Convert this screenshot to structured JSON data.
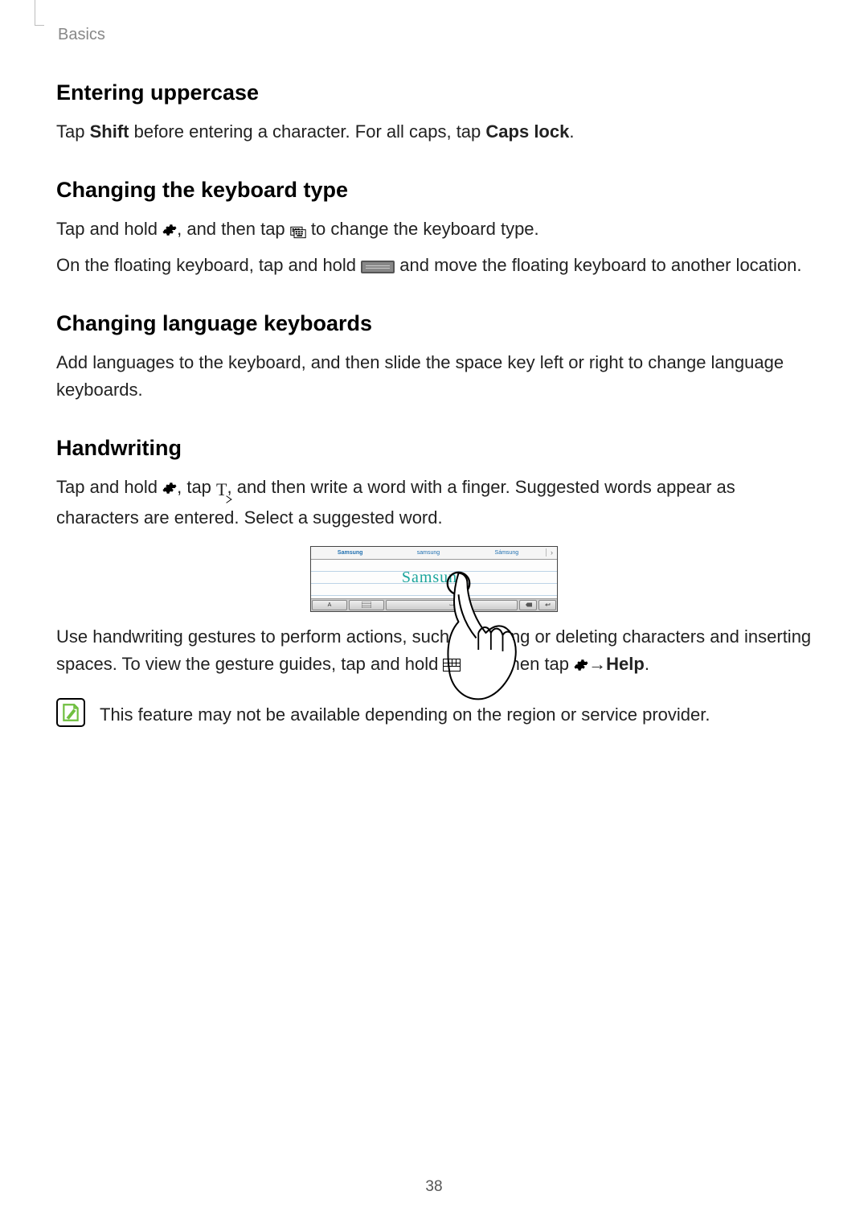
{
  "breadcrumb": "Basics",
  "page_number": "38",
  "sections": {
    "uppercase": {
      "title": "Entering uppercase",
      "p1_a": "Tap ",
      "p1_b": "Shift",
      "p1_c": " before entering a character. For all caps, tap ",
      "p1_d": "Caps lock",
      "p1_e": "."
    },
    "kbtype": {
      "title": "Changing the keyboard type",
      "p1_a": "Tap and hold ",
      "p1_b": ", and then tap ",
      "p1_c": " to change the keyboard type.",
      "p2_a": "On the floating keyboard, tap and hold ",
      "p2_b": " and move the floating keyboard to another location."
    },
    "lang": {
      "title": "Changing language keyboards",
      "p1": "Add languages to the keyboard, and then slide the space key left or right to change language keyboards."
    },
    "hand": {
      "title": "Handwriting",
      "p1_a": "Tap and hold ",
      "p1_b": ", tap ",
      "p1_c": ", and then write a word with a finger. Suggested words appear as characters are entered. Select a suggested word.",
      "p2_a": "Use handwriting gestures to perform actions, such as editing or deleting characters and inserting spaces. To view the gesture guides, tap and hold ",
      "p2_b": ", and then tap ",
      "p2_c": " → ",
      "p2_d": "Help",
      "p2_e": "."
    }
  },
  "figure": {
    "suggestions": [
      "Samsung",
      "samsung",
      "Sámsung"
    ],
    "written_word": "Samsung",
    "more_glyph": "›",
    "keys": {
      "a": "A",
      "space": "⌴"
    }
  },
  "note": {
    "text": "This feature may not be available depending on the region or service provider."
  }
}
